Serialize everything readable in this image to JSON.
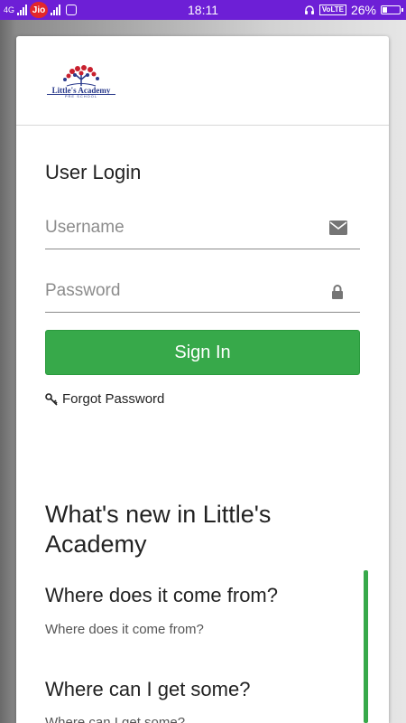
{
  "status_bar": {
    "signal_left_text": "4G",
    "carrier": "Jio",
    "time": "18:11",
    "volte": "VoLTE",
    "battery": "26%",
    "icons": [
      "network-type-icon",
      "signal-bars-icon",
      "app-notification-icon",
      "headset-icon",
      "battery-charging-icon"
    ],
    "accent_color": "#6d1fd6",
    "battery_level": 0.26
  },
  "header": {
    "logo_text": "Little's Academy",
    "logo_subtext": "PRE SCHOOL"
  },
  "login": {
    "title": "User Login",
    "username_placeholder": "Username",
    "password_placeholder": "Password",
    "signin_label": "Sign In",
    "forgot_label": "Forgot Password",
    "button_color": "#37a94a"
  },
  "news": {
    "title": "What's new in Little's Academy",
    "items": [
      {
        "title": "Where does it come from?",
        "body": "Where does it come from?"
      },
      {
        "title": "Where can I get some?",
        "body": "Where can I get some?"
      }
    ]
  }
}
